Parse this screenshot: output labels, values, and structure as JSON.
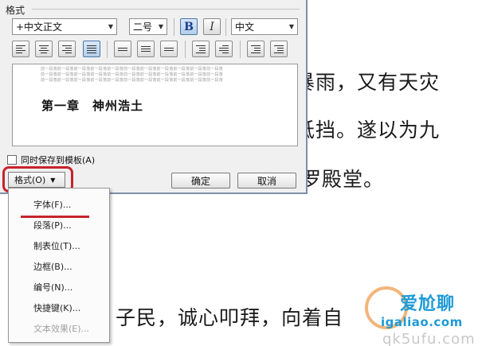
{
  "document": {
    "lines": [
      "暴雨，又有天灾",
      "抵挡。遂以为九",
      "罗殿堂。",
      "子民，诚心叩拜，向着自"
    ]
  },
  "dialog": {
    "group_title": "格式",
    "font_name": "+中文正文",
    "font_size": "二号",
    "bold_label": "B",
    "italic_label": "I",
    "language": "中文",
    "preview": {
      "sample_text": "前一段落前一段落前一段落前一段落前一段落前一段落前一段落前一段落前一段落前一段落前一段落",
      "heading": "第一章　神州浩土"
    },
    "save_to_template": "同时保存到模板(A)",
    "format_button": "格式(O)",
    "ok": "确定",
    "cancel": "取消"
  },
  "format_menu": {
    "items": [
      {
        "label": "字体(F)...",
        "enabled": true
      },
      {
        "label": "段落(P)...",
        "enabled": true
      },
      {
        "label": "制表位(T)...",
        "enabled": true
      },
      {
        "label": "边框(B)...",
        "enabled": true
      },
      {
        "label": "编号(N)...",
        "enabled": true
      },
      {
        "label": "快捷键(K)...",
        "enabled": true
      },
      {
        "label": "文本效果(E)...",
        "enabled": false
      }
    ]
  },
  "watermark": {
    "title": "爱尬聊",
    "url": "igaliao.com",
    "ghost": "qk5ufu.com"
  },
  "colors": {
    "highlight": "#c8232c",
    "watermark_blue": "#1e9ad6"
  }
}
